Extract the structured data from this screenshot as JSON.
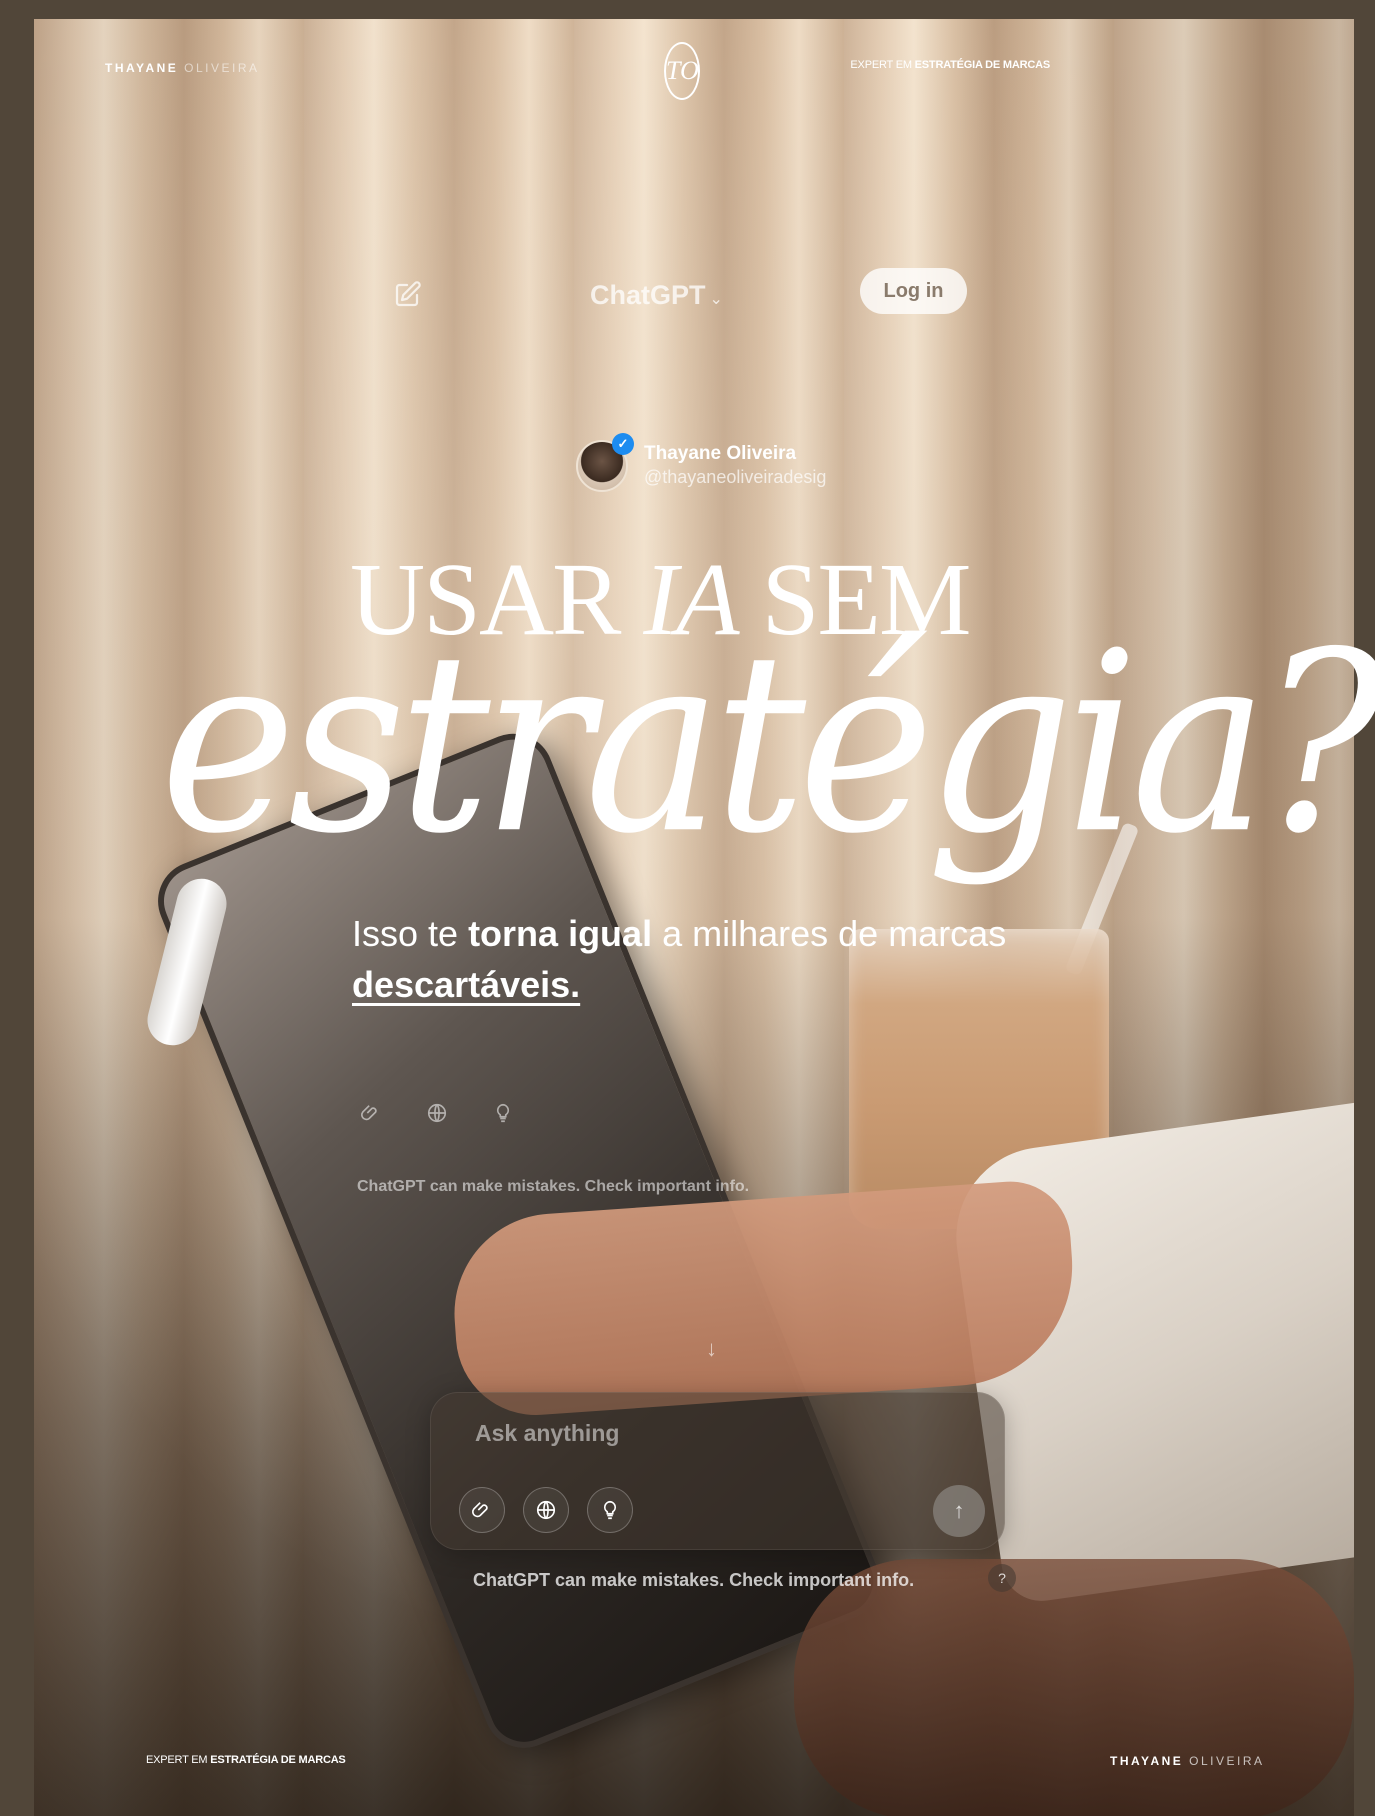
{
  "brand": {
    "first_name": "THAYANE",
    "last_name": "OLIVEIRA",
    "logo_monogram": "TO",
    "tagline_prefix": "EXPERT EM",
    "tagline_bold": "ESTRATÉGIA DE MARCAS"
  },
  "chat_header": {
    "title": "ChatGPT",
    "chevron": "⌄",
    "login_label": "Log in",
    "edit_icon": "edit-icon"
  },
  "profile": {
    "name": "Thayane Oliveira",
    "handle": "@thayaneoliveiradesig",
    "verified_mark": "✓"
  },
  "headline": {
    "line1_a": "USAR",
    "line1_ia": "IA",
    "line1_b": "SEM",
    "line2": "estratégia?"
  },
  "body": {
    "part1": "Isso te ",
    "bold1": "torna igual",
    "part2": " a milhares de marcas ",
    "bold2": "descartáveis."
  },
  "ghost": {
    "note": "ChatGPT can make mistakes. Check important info.",
    "scroll_arrow": "↓"
  },
  "composer": {
    "placeholder": "Ask anything",
    "send_symbol": "↑",
    "tools": [
      "paperclip-icon",
      "globe-icon",
      "lightbulb-icon"
    ]
  },
  "footer": {
    "disclaimer": "ChatGPT can make mistakes. Check important info.",
    "help": "?"
  },
  "colors": {
    "background": "#514639",
    "text": "#ffffff",
    "verified": "#1d8cf0"
  }
}
